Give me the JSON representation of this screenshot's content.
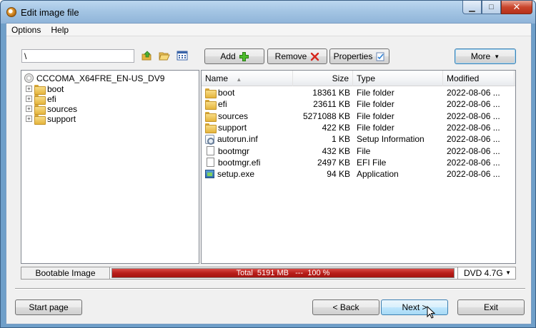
{
  "window": {
    "title": "Edit image file"
  },
  "title_buttons": {
    "minimize": "▁",
    "maximize": "□",
    "close": "✕"
  },
  "menu": [
    "Options",
    "Help"
  ],
  "toolbar": {
    "path_value": "\\",
    "add_label": "Add",
    "remove_label": "Remove",
    "properties_label": "Properties",
    "more_label": "More",
    "more_arrow": "▼"
  },
  "tree": {
    "root": "CCCOMA_X64FRE_EN-US_DV9",
    "children": [
      "boot",
      "efi",
      "sources",
      "support"
    ],
    "expander": "+"
  },
  "list": {
    "columns": {
      "name": "Name",
      "size": "Size",
      "type": "Type",
      "modified": "Modified"
    },
    "sort_arrow": "▲",
    "rows": [
      {
        "name": "boot",
        "size": "18361 KB",
        "type": "File folder",
        "modified": "2022-08-06 ...",
        "icon": "folder-icon"
      },
      {
        "name": "efi",
        "size": "23611 KB",
        "type": "File folder",
        "modified": "2022-08-06 ...",
        "icon": "folder-icon"
      },
      {
        "name": "sources",
        "size": "5271088 KB",
        "type": "File folder",
        "modified": "2022-08-06 ...",
        "icon": "folder-icon"
      },
      {
        "name": "support",
        "size": "422 KB",
        "type": "File folder",
        "modified": "2022-08-06 ...",
        "icon": "folder-icon"
      },
      {
        "name": "autorun.inf",
        "size": "1 KB",
        "type": "Setup Information",
        "modified": "2022-08-06 ...",
        "icon": "inf-icon"
      },
      {
        "name": "bootmgr",
        "size": "432 KB",
        "type": "File",
        "modified": "2022-08-06 ...",
        "icon": "file-icon"
      },
      {
        "name": "bootmgr.efi",
        "size": "2497 KB",
        "type": "EFI File",
        "modified": "2022-08-06 ...",
        "icon": "file-icon"
      },
      {
        "name": "setup.exe",
        "size": "94 KB",
        "type": "Application",
        "modified": "2022-08-06 ...",
        "icon": "exe-icon"
      }
    ]
  },
  "status": {
    "label": "Bootable Image",
    "progress_text": "Total  5191 MB   ---  100 %",
    "progress_fraction": 1.0,
    "disc_type": "DVD 4.7G",
    "disc_arrow": "▼"
  },
  "footer": {
    "start_page": "Start page",
    "back": "< Back",
    "next": "Next >",
    "exit": "Exit"
  },
  "colors": {
    "progress": "#b81e1a",
    "folder": "#e4b43c",
    "titlebar": "#a4c5e4"
  }
}
